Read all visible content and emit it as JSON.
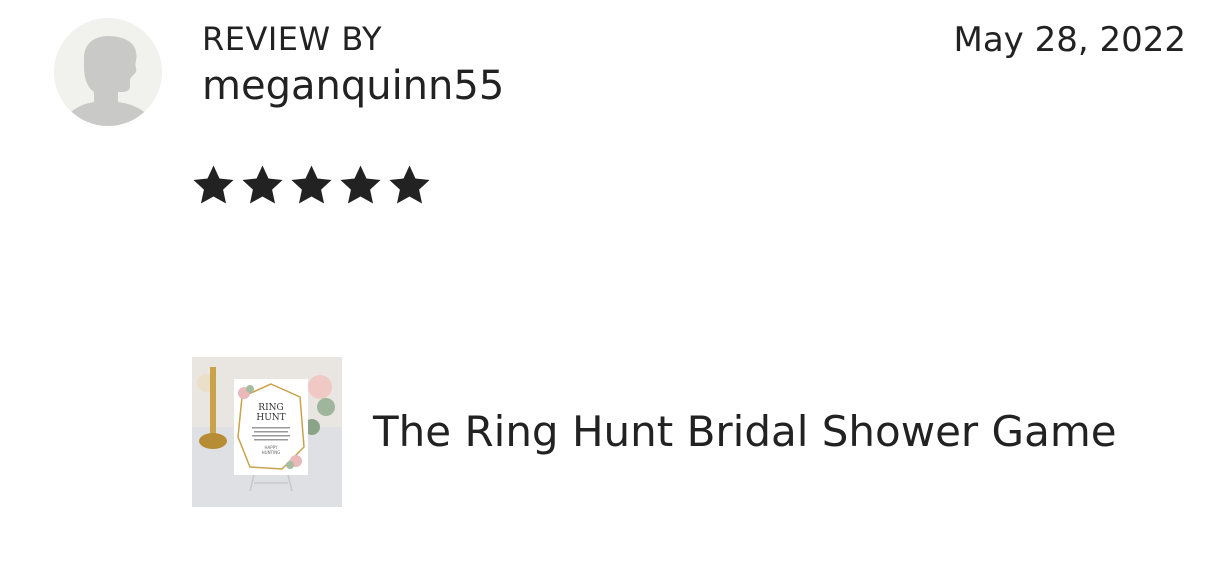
{
  "review": {
    "label": "REVIEW BY",
    "username": "meganquinn55",
    "date": "May 28, 2022",
    "rating": 5,
    "rating_max": 5,
    "star_color": "#222222"
  },
  "listing": {
    "title": "The Ring Hunt Bridal Shower Game",
    "thumbnail": {
      "heading_line1": "RING",
      "heading_line2": "HUNT",
      "footer_line1": "HAPPY",
      "footer_line2": "HUNTING"
    }
  },
  "icons": {
    "avatar": "default-user-avatar-icon",
    "star": "filled-star-icon"
  }
}
